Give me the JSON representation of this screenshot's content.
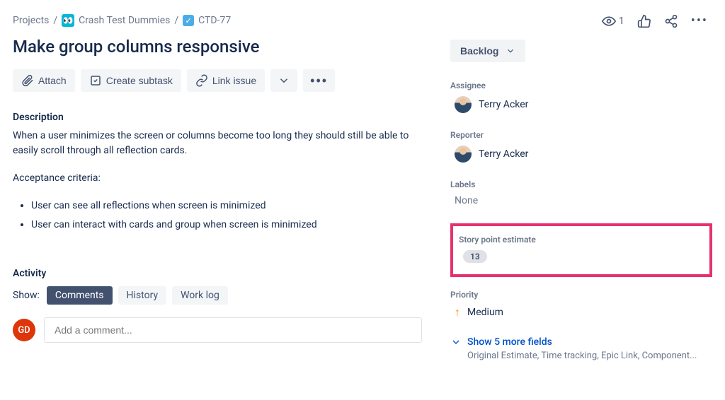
{
  "breadcrumb": {
    "root": "Projects",
    "project": "Crash Test Dummies",
    "key": "CTD-77"
  },
  "topbar": {
    "watch_count": "1"
  },
  "issue": {
    "title": "Make group columns responsive",
    "actions": {
      "attach": "Attach",
      "subtask": "Create subtask",
      "link": "Link issue"
    },
    "description_label": "Description",
    "description_body": "When a user minimizes the screen or columns become too long they should still be able to easily scroll through all reflection cards.",
    "acceptance_label": "Acceptance criteria:",
    "acceptance": [
      "User can see all reflections when screen is minimized",
      "User can interact with cards and group when screen is minimized"
    ]
  },
  "activity": {
    "heading": "Activity",
    "show_label": "Show:",
    "tabs": {
      "comments": "Comments",
      "history": "History",
      "worklog": "Work log"
    },
    "commenter_initials": "GD",
    "comment_placeholder": "Add a comment..."
  },
  "side": {
    "status": "Backlog",
    "assignee_label": "Assignee",
    "assignee_value": "Terry Acker",
    "reporter_label": "Reporter",
    "reporter_value": "Terry Acker",
    "labels_label": "Labels",
    "labels_value": "None",
    "sp_label": "Story point estimate",
    "sp_value": "13",
    "priority_label": "Priority",
    "priority_value": "Medium",
    "show_more": "Show 5 more fields",
    "show_more_sub": "Original Estimate, Time tracking, Epic Link, Component..."
  }
}
